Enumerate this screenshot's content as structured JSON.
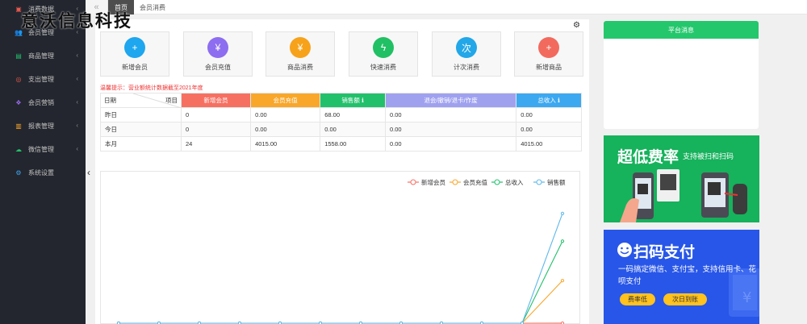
{
  "brand_watermark": "意沃信息科技",
  "sidebar": {
    "items": [
      {
        "label": "消费数据",
        "icon": "data-icon"
      },
      {
        "label": "会员管理",
        "icon": "users-icon"
      },
      {
        "label": "商品管理",
        "icon": "chart-icon"
      },
      {
        "label": "支出管理",
        "icon": "expense-icon"
      },
      {
        "label": "会员营销",
        "icon": "gift-icon"
      },
      {
        "label": "报表管理",
        "icon": "report-icon"
      },
      {
        "label": "微信管理",
        "icon": "wechat-icon"
      },
      {
        "label": "系统设置",
        "icon": "gear-icon"
      }
    ]
  },
  "tabs": {
    "collapse_label": "«",
    "items": [
      {
        "label": "首页"
      },
      {
        "label": "会员消费"
      }
    ]
  },
  "quick_actions": [
    {
      "label": "新增会员",
      "icon": "add-user-icon",
      "color": "#1ea6ef",
      "glyph": "+"
    },
    {
      "label": "会员充值",
      "icon": "yen-icon",
      "color": "#8d6df0",
      "glyph": "¥"
    },
    {
      "label": "商品消费",
      "icon": "coin-icon",
      "color": "#f7a21b",
      "glyph": "¥"
    },
    {
      "label": "快速消费",
      "icon": "lightning-icon",
      "color": "#22c064",
      "glyph": "ϟ"
    },
    {
      "label": "计次消费",
      "icon": "count-icon",
      "color": "#22a7e8",
      "glyph": "次"
    },
    {
      "label": "新增商品",
      "icon": "add-product-icon",
      "color": "#f26a5e",
      "glyph": "+"
    }
  ],
  "note": "温馨提示：营业额统计数据截至2021年度",
  "table": {
    "corner_left": "日期",
    "corner_right": "项目",
    "headers": [
      {
        "label": "新增会员",
        "color": "#f67062"
      },
      {
        "label": "会员充值",
        "color": "#f8a72a"
      },
      {
        "label": "销售额 ℹ",
        "color": "#22c06b"
      },
      {
        "label": "退会/撤销/退卡/作废",
        "color": "#9fa1ef"
      },
      {
        "label": "总收入 ℹ",
        "color": "#3ca8f0"
      }
    ],
    "rows": [
      {
        "label": "昨日",
        "values": [
          "0",
          "0.00",
          "68.00",
          "0.00",
          "0.00"
        ]
      },
      {
        "label": "今日",
        "values": [
          "0",
          "0.00",
          "0.00",
          "0.00",
          "0.00"
        ]
      },
      {
        "label": "本月",
        "values": [
          "24",
          "4015.00",
          "1558.00",
          "0.00",
          "4015.00"
        ]
      }
    ]
  },
  "chart_data": {
    "type": "line",
    "x": [
      "",
      "",
      "",
      "",
      "",
      "",
      "",
      "",
      "",
      "",
      "",
      ""
    ],
    "series": [
      {
        "name": "新增会员",
        "color": "#f67062",
        "values": [
          0,
          0,
          0,
          0,
          0,
          0,
          0,
          0,
          0,
          0,
          0,
          1
        ]
      },
      {
        "name": "会员充值",
        "color": "#f8a72a",
        "values": [
          0,
          0,
          0,
          0,
          0,
          0,
          0,
          0,
          0,
          0,
          0,
          1558
        ]
      },
      {
        "name": "总收入",
        "color": "#22c06b",
        "values": [
          0,
          0,
          0,
          0,
          0,
          0,
          0,
          0,
          0,
          0,
          0,
          3000
        ]
      },
      {
        "name": "销售额",
        "color": "#5db8ea",
        "values": [
          0,
          0,
          0,
          0,
          0,
          0,
          0,
          0,
          0,
          0,
          0,
          4015
        ]
      }
    ],
    "ylim": [
      0,
      4600
    ],
    "legend_position": "top-right",
    "grid": false
  },
  "notice": {
    "title": "平台消息"
  },
  "ad1": {
    "title": "超低费率",
    "subtitle": "支持被扫和扫码"
  },
  "ad2": {
    "title": "扫码支付",
    "desc": "一码搞定微信、支付宝，支持信用卡、花呗支付",
    "btn1": "费率低",
    "btn2": "次日到账"
  }
}
